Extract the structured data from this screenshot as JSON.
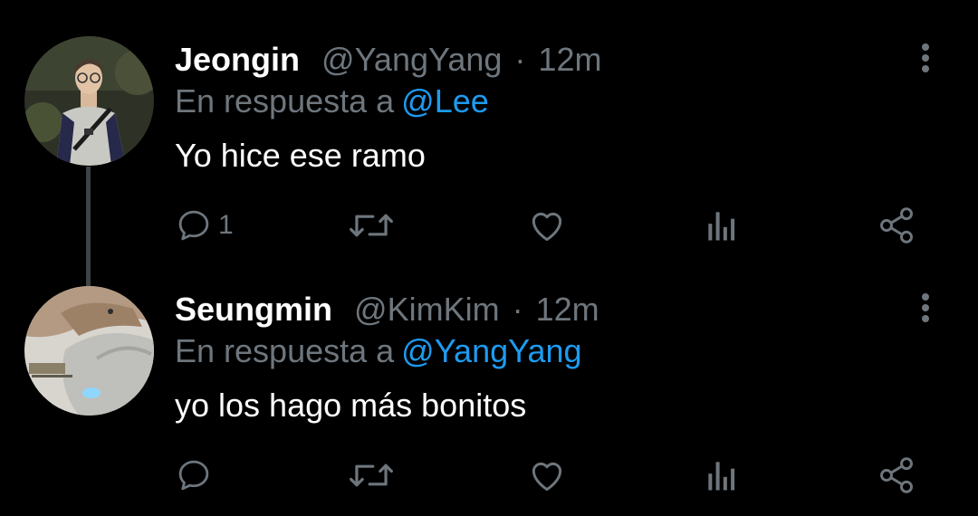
{
  "tweets": [
    {
      "name": "Jeongin",
      "handle": "@YangYang",
      "separator": "·",
      "time": "12m",
      "reply_prefix": "En respuesta a",
      "reply_to": "@Lee",
      "text": "Yo hice ese ramo",
      "reply_count": "1"
    },
    {
      "name": "Seungmin",
      "handle": "@KimKim",
      "separator": "·",
      "time": "12m",
      "reply_prefix": "En respuesta a",
      "reply_to": "@YangYang",
      "text": "yo los hago más bonitos",
      "reply_count": ""
    }
  ],
  "icons": {
    "reply": "reply-icon",
    "retweet": "retweet-icon",
    "like": "heart-icon",
    "analytics": "analytics-icon",
    "share": "share-icon",
    "more": "more-icon"
  },
  "colors": {
    "background": "#000000",
    "name": "#ffffff",
    "muted": "#6e767d",
    "mention": "#1d9bf0",
    "thread_line": "#3d4347"
  }
}
